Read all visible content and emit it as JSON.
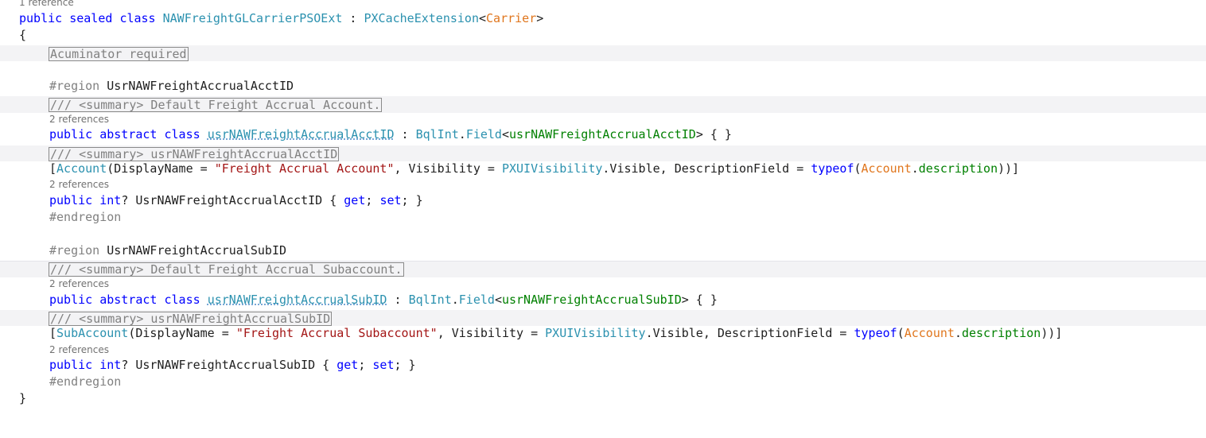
{
  "code": {
    "lens_top": "1 reference",
    "lens_refs": "2 references",
    "class_decl": {
      "kw1": "public",
      "kw2": "sealed",
      "kw3": "class",
      "name": "NAWFreightGLCarrierPSOExt",
      "colon": " : ",
      "base": "PXCacheExtension",
      "lt": "<",
      "generic": "Carrier",
      "gt": ">"
    },
    "open_brace": "{",
    "close_brace": "}",
    "acuminator_box": "Acuminator required",
    "region_kw": "#region",
    "endregion_kw": "#endregion",
    "region1_name": "UsrNAWFreightAccrualAcctID",
    "region2_name": "UsrNAWFreightAccrualSubID",
    "summary1": "/// <summary> Default Freight Accrual Account.",
    "summary2": "/// <summary> usrNAWFreightAccrualAcctID",
    "summary3": "/// <summary> Default Freight Accrual Subaccount.",
    "summary4": "/// <summary> usrNAWFreightAccrualSubID",
    "kw_public": "public",
    "kw_abstract": "abstract",
    "kw_class": "class",
    "kw_int": "int",
    "kw_get": "get",
    "kw_set": "set",
    "kw_typeof": "typeof",
    "field1_name": "usrNAWFreightAccrualAcctID",
    "field2_name": "usrNAWFreightAccrualSubID",
    "bql_type": "BqlInt",
    "field_word": "Field",
    "empty_body": "> { }",
    "attr1_name": "Account",
    "attr2_name": "SubAccount",
    "display_name_eq": "(DisplayName = ",
    "attr1_str": "\"Freight Accrual Account\"",
    "attr2_str": "\"Freight Accrual Subaccount\"",
    "visibility_eq": ", Visibility = ",
    "visibility_type": "PXUIVisibility",
    "visible_member": ".Visible, DescriptionField = ",
    "desc_type": "Account",
    "desc_member": "description",
    "attr_end": "))]",
    "prop1_name": " UsrNAWFreightAccrualAcctID { ",
    "prop2_name": " UsrNAWFreightAccrualSubID { ",
    "nullable": "?",
    "semi_sp": "; ",
    "semi_close": "; }"
  },
  "colors": {
    "keyword": "#0000ff",
    "type": "#2b91af",
    "generic_param": "#e0761d",
    "nested_type": "#008000",
    "string": "#a31515",
    "comment": "#808080"
  }
}
